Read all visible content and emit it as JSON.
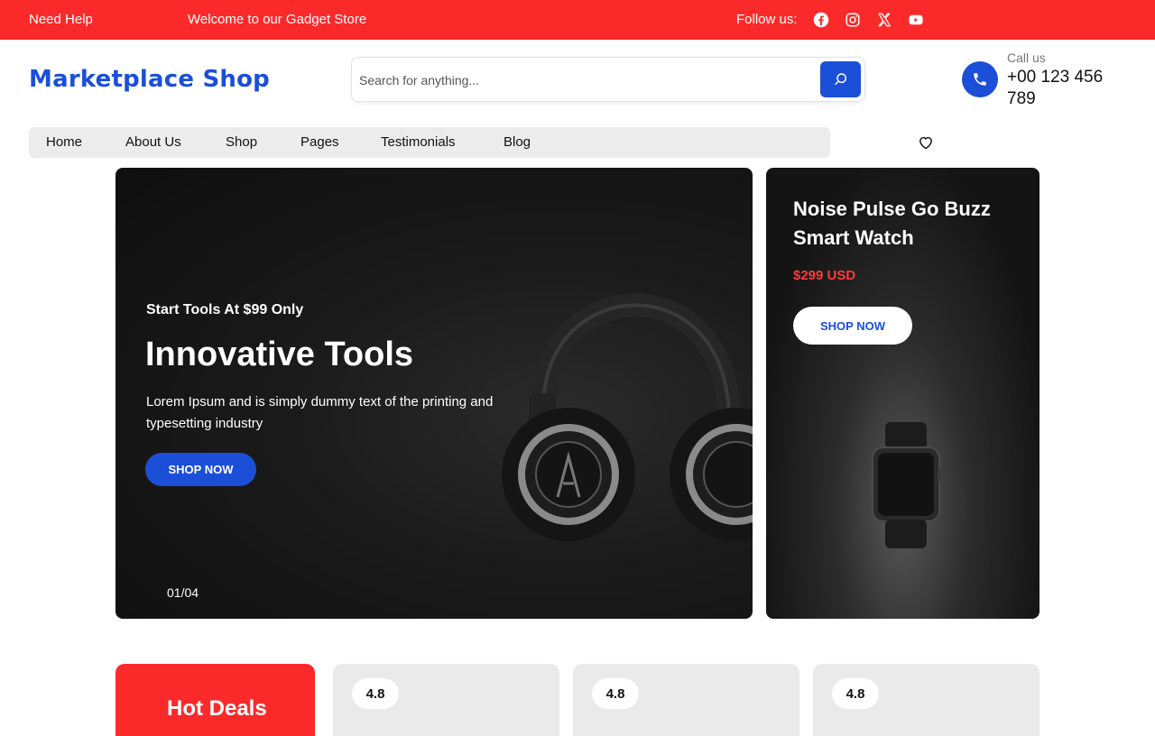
{
  "topbar": {
    "need_help": "Need Help",
    "welcome": "Welcome to our Gadget Store",
    "follow_label": "Follow us:",
    "social_icons": [
      "facebook-icon",
      "instagram-icon",
      "x-icon",
      "youtube-icon"
    ],
    "bg_color": "#fb2a2a"
  },
  "header": {
    "logo": "Marketplace Shop",
    "search_placeholder": "Search for anything...",
    "call_label": "Call us",
    "call_number": "+00 123 456 789",
    "accent_color": "#1b4fd8"
  },
  "nav": {
    "items": [
      "Home",
      "About Us",
      "Shop",
      "Pages",
      "Testimonials",
      "Blog"
    ]
  },
  "hero": {
    "eyebrow": "Start Tools At $99 Only",
    "headline": "Innovative Tools",
    "description": "Lorem Ipsum and is simply dummy text of the printing and typesetting industry",
    "button": "SHOP NOW",
    "counter": "01/04"
  },
  "promo": {
    "title": "Noise Pulse Go Buzz Smart Watch",
    "price": "$299 USD",
    "button": "SHOP NOW"
  },
  "deals": {
    "title": "Hot Deals",
    "cards": [
      {
        "rating": "4.8"
      },
      {
        "rating": "4.8"
      },
      {
        "rating": "4.8"
      }
    ]
  }
}
